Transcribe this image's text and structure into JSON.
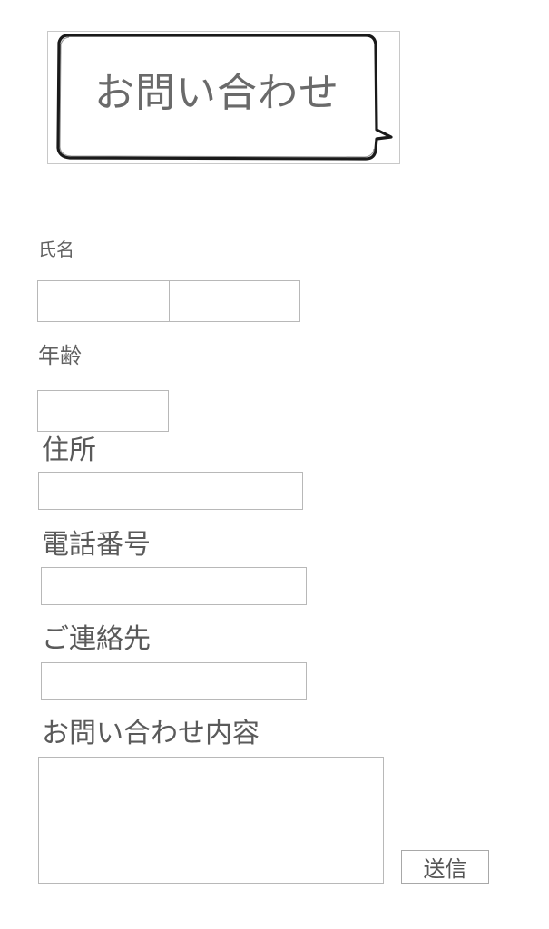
{
  "header": {
    "title": "お問い合わせ"
  },
  "form": {
    "name": {
      "label": "氏名",
      "last_value": "",
      "first_value": ""
    },
    "age": {
      "label": "年齢",
      "value": ""
    },
    "address": {
      "label": "住所",
      "value": ""
    },
    "phone": {
      "label": "電話番号",
      "value": ""
    },
    "contact": {
      "label": "ご連絡先",
      "value": ""
    },
    "inquiry": {
      "label": "お問い合わせ内容",
      "value": ""
    },
    "submit_label": "送信"
  },
  "icons": {
    "header_bubble": "speech-bubble-icon"
  }
}
